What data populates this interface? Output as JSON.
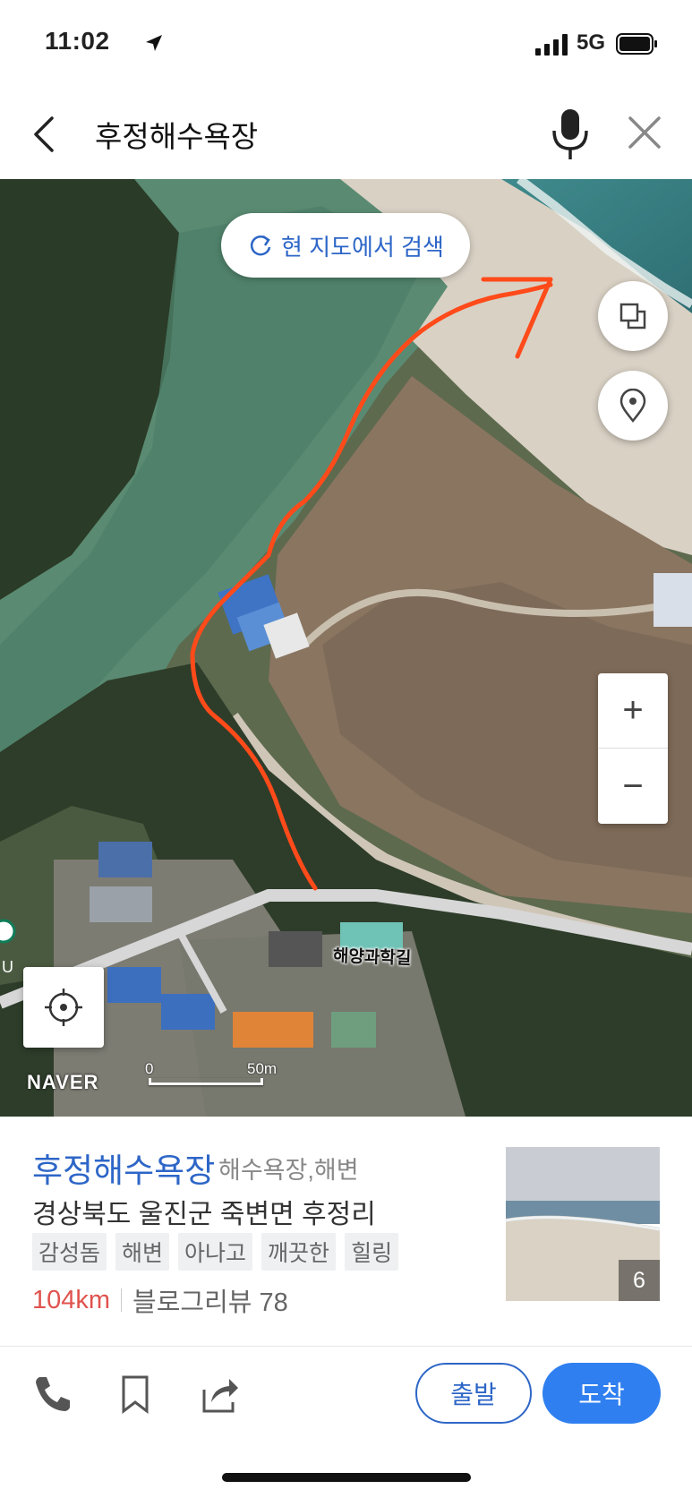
{
  "status_bar": {
    "time": "11:02",
    "network": "5G",
    "location_icon": "location-arrow-icon",
    "signal_icon": "signal-bars-icon",
    "battery_icon": "battery-icon"
  },
  "search": {
    "query": "후정해수욕장",
    "back_icon": "chevron-left-icon",
    "mic_icon": "microphone-icon",
    "clear_icon": "close-icon"
  },
  "map": {
    "search_here_label": "현 지도에서 검색",
    "refresh_icon": "refresh-icon",
    "layers_icon": "layers-icon",
    "pin_icon": "map-pin-icon",
    "zoom_in": "+",
    "zoom_out": "−",
    "locate_icon": "crosshair-icon",
    "road_label": "해양과학길",
    "brand": "NAVER",
    "scale_zero": "0",
    "scale_distance": "50m",
    "annotation_color": "#ff4a1a"
  },
  "place": {
    "name": "후정해수욕장",
    "category": "해수욕장,해변",
    "address": "경상북도 울진군 죽변면 후정리",
    "tags": [
      "감성돔",
      "해변",
      "아나고",
      "깨끗한",
      "힐링"
    ],
    "distance": "104km",
    "reviews": "블로그리뷰 78",
    "photo_count": "6"
  },
  "actions": {
    "call_icon": "phone-icon",
    "save_icon": "bookmark-icon",
    "share_icon": "share-icon",
    "depart_label": "출발",
    "arrive_label": "도착"
  },
  "colors": {
    "brand_blue": "#2d66c7",
    "arrive_blue": "#2f7ff0",
    "distance_red": "#e0534e"
  }
}
